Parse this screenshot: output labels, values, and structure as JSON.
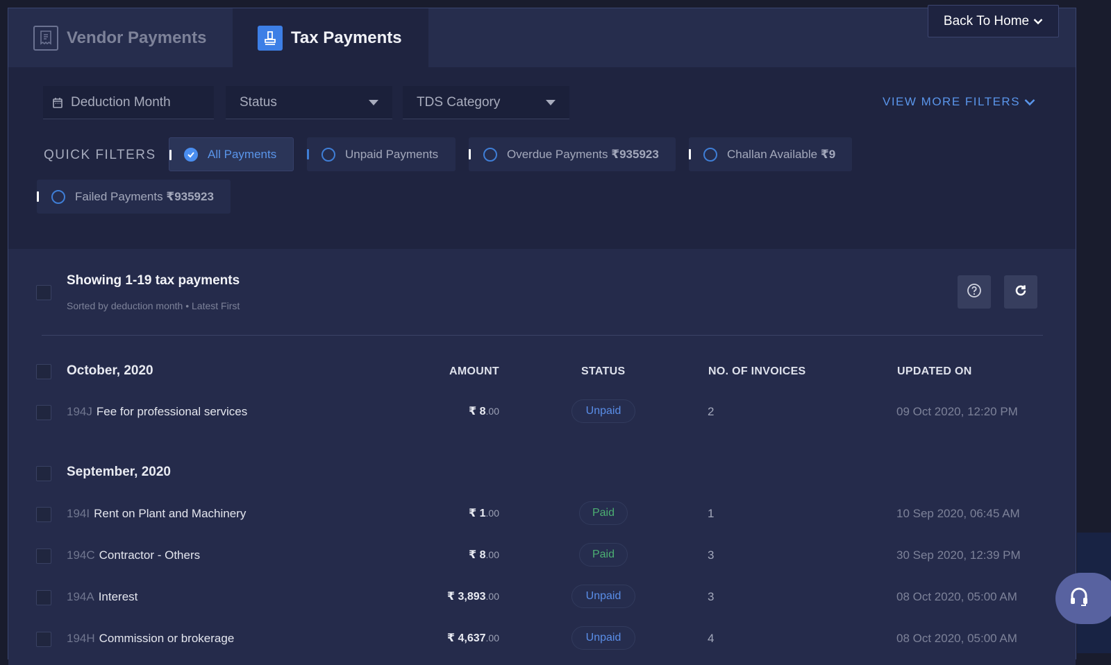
{
  "tabs": [
    {
      "label": "Vendor Payments",
      "icon": "receipt-icon",
      "active": false
    },
    {
      "label": "Tax Payments",
      "icon": "stamp-icon",
      "active": true
    }
  ],
  "header": {
    "back_home_label": "Back To Home"
  },
  "filters": {
    "deduction_month_placeholder": "Deduction Month",
    "status_placeholder": "Status",
    "tds_category_placeholder": "TDS Category",
    "view_more_label": "VIEW MORE FILTERS"
  },
  "quick_filters": {
    "label": "QUICK FILTERS",
    "items": [
      {
        "label": "All Payments",
        "amount": "",
        "selected": true
      },
      {
        "label": "Unpaid Payments",
        "amount": "",
        "selected": false
      },
      {
        "label": "Overdue Payments",
        "amount": "₹935923",
        "selected": false
      },
      {
        "label": "Challan Available",
        "amount": "₹9",
        "selected": false
      },
      {
        "label": "Failed Payments",
        "amount": "₹935923",
        "selected": false
      }
    ]
  },
  "list": {
    "title": "Showing 1-19 tax payments",
    "subtitle": "Sorted by deduction month • Latest First",
    "columns": {
      "amount": "AMOUNT",
      "status": "STATUS",
      "invoices": "NO. OF INVOICES",
      "updated": "UPDATED ON"
    },
    "groups": [
      {
        "title": "October, 2020",
        "rows": [
          {
            "code": "194J",
            "description": "Fee for professional services",
            "currency": "₹",
            "amount": "8",
            "decimals": ".00",
            "status": "Unpaid",
            "invoices": "2",
            "updated_on": "09 Oct 2020, 12:20 PM"
          }
        ]
      },
      {
        "title": "September, 2020",
        "rows": [
          {
            "code": "194I",
            "description": "Rent on Plant and Machinery",
            "currency": "₹",
            "amount": "1",
            "decimals": ".00",
            "status": "Paid",
            "invoices": "1",
            "updated_on": "10 Sep 2020, 06:45 AM"
          },
          {
            "code": "194C",
            "description": "Contractor - Others",
            "currency": "₹",
            "amount": "8",
            "decimals": ".00",
            "status": "Paid",
            "invoices": "3",
            "updated_on": "30 Sep 2020, 12:39 PM"
          },
          {
            "code": "194A",
            "description": "Interest",
            "currency": "₹",
            "amount": "3,893",
            "decimals": ".00",
            "status": "Unpaid",
            "invoices": "3",
            "updated_on": "08 Oct 2020, 05:00 AM"
          },
          {
            "code": "194H",
            "description": "Commission or brokerage",
            "currency": "₹",
            "amount": "4,637",
            "decimals": ".00",
            "status": "Unpaid",
            "invoices": "4",
            "updated_on": "08 Oct 2020, 05:00 AM"
          }
        ]
      }
    ]
  },
  "colors": {
    "accent": "#3d7fe6",
    "link": "#5a95ea",
    "paid": "#4caf72",
    "unpaid": "#5a8ee8",
    "background": "#222844"
  }
}
